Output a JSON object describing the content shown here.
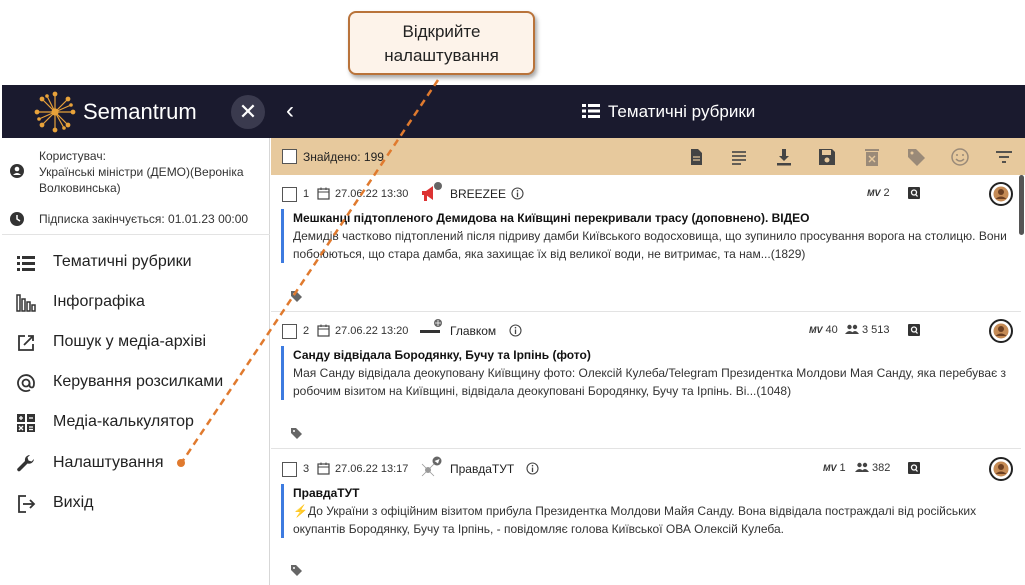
{
  "callout": {
    "text": "Відкрийте налаштування"
  },
  "topbar": {
    "brand": "Semantrum",
    "close_label": "✕",
    "back_label": "‹",
    "title": "Тематичні рубрики"
  },
  "user": {
    "label": "Користувач:",
    "name": "Українські міністри (ДЕМО)(Вероніка Волковинська)",
    "subscription": "Підписка закінчується: 01.01.23 00:00"
  },
  "nav": [
    {
      "label": "Тематичні рубрики",
      "icon": "list-icon"
    },
    {
      "label": "Інфографіка",
      "icon": "chart-icon"
    },
    {
      "label": "Пошук у медіа-архіві",
      "icon": "external-link-icon"
    },
    {
      "label": "Керування розсилками",
      "icon": "at-icon"
    },
    {
      "label": "Медіа-калькулятор",
      "icon": "calculator-icon"
    },
    {
      "label": "Налаштування",
      "icon": "wrench-icon"
    },
    {
      "label": "Вихід",
      "icon": "logout-icon"
    }
  ],
  "toolbar": {
    "found": "Знайдено: 199",
    "icons": [
      "document-icon",
      "lines-icon",
      "download-icon",
      "save-icon",
      "delete-icon",
      "tag-icon",
      "smile-icon",
      "filter-icon"
    ]
  },
  "articles": [
    {
      "num": "1",
      "date": "27.06.22 13:30",
      "source": "BREEZEE",
      "mv": "2",
      "reach": "",
      "title": "Мешканці підтопленого Демидова на Київщині перекривали трасу (доповнено). ВІДЕО",
      "text": "Демидів частково підтоплений після підриву дамби Київського водосховища, що зупинило просування ворога на столицю. Вони побоюються, що стара дамба, яка захищає їх від великої води, не витримає, та нам...(1829)"
    },
    {
      "num": "2",
      "date": "27.06.22 13:20",
      "source": "Главком",
      "mv": "40",
      "reach": "3 513",
      "title": "Санду відвідала Бородянку, Бучу та Ірпінь (фото)",
      "text": "Мая Санду відвідала деокуповану Київщину фото: Олексій Кулеба/Telegram Президентка Молдови Мая Санду, яка перебуває з робочим візитом на Київщині, відвідала деокуповані Бородянку, Бучу та Ірпінь. Ві...(1048)"
    },
    {
      "num": "3",
      "date": "27.06.22 13:17",
      "source": "ПравдаТУТ",
      "mv": "1",
      "reach": "382",
      "title": "ПравдаТУТ",
      "text": "⚡️До України з офіційним візитом прибула Президентка Молдови Майя Санду. Вона відвідала постраждалі від російських окупантів Бородянку, Бучу та Ірпінь, - повідомляє голова Київської ОВА Олексій Кулеба."
    }
  ],
  "colors": {
    "topbar": "#1a1a2e",
    "toolbar": "#e7c99d",
    "accent": "#3d7be0",
    "arrow": "#e07a2e"
  }
}
